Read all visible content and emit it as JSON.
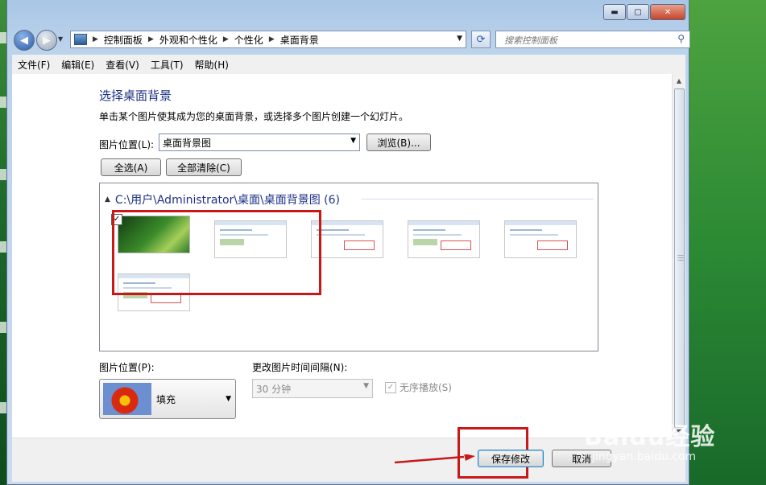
{
  "window": {
    "min_symbol": "▬",
    "max_symbol": "▢",
    "close_symbol": "✕"
  },
  "nav": {
    "breadcrumbs": [
      "控制面板",
      "外观和个性化",
      "个性化",
      "桌面背景"
    ],
    "search_placeholder": "搜索控制面板"
  },
  "menu": [
    "文件(F)",
    "编辑(E)",
    "查看(V)",
    "工具(T)",
    "帮助(H)"
  ],
  "page": {
    "title": "选择桌面背景",
    "description": "单击某个图片使其成为您的桌面背景，或选择多个图片创建一个幻灯片。",
    "location_label": "图片位置(L):",
    "location_value": "桌面背景图",
    "browse_label": "浏览(B)...",
    "select_all_label": "全选(A)",
    "clear_all_label": "全部清除(C)"
  },
  "gallery": {
    "group_title": "C:\\用户\\Administrator\\桌面\\桌面背景图 (6)",
    "selected_index": 0,
    "image_count": 6
  },
  "options": {
    "position_label": "图片位置(P):",
    "position_value": "填充",
    "interval_label": "更改图片时间间隔(N):",
    "interval_value": "30 分钟",
    "shuffle_label": "无序播放(S)",
    "shuffle_checked": true
  },
  "footer": {
    "save_label": "保存修改",
    "cancel_label": "取消"
  },
  "watermark": {
    "logo": "Baidu经验",
    "url": "jingyan.baidu.com"
  },
  "colors": {
    "title_blue": "#1e3287",
    "highlight_red": "#c81818"
  }
}
